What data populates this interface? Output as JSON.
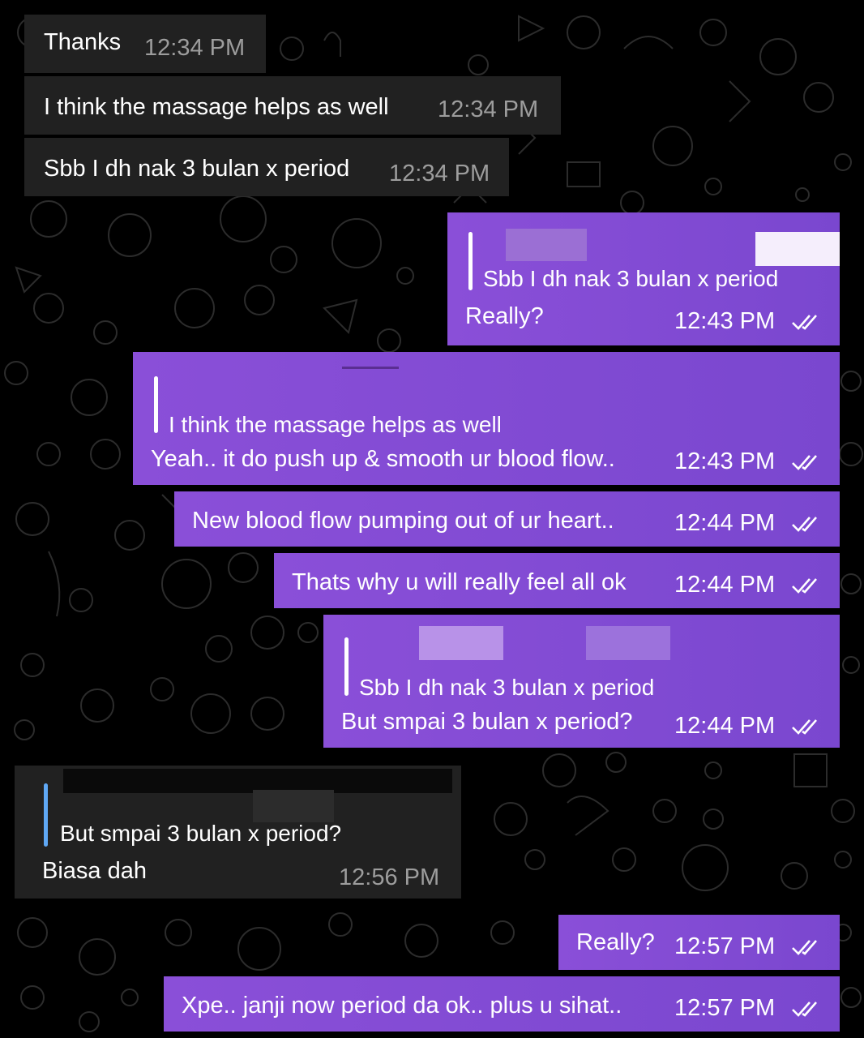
{
  "colors": {
    "background": "#000000",
    "incoming_bubble": "#212121",
    "outgoing_bubble": "#8448d6",
    "reply_bar_incoming": "#5fa8f5",
    "timestamp_incoming": "#9d9d9d"
  },
  "messages": [
    {
      "direction": "in",
      "text": "Thanks",
      "time": "12:34 PM"
    },
    {
      "direction": "in",
      "text": "I think the massage helps as well",
      "time": "12:34 PM"
    },
    {
      "direction": "in",
      "text": "Sbb I dh nak 3 bulan x period",
      "time": "12:34 PM"
    },
    {
      "direction": "out",
      "quote": "Sbb I dh nak 3 bulan x period",
      "text": "Really?",
      "time": "12:43 PM",
      "status_icon": "double-check-icon"
    },
    {
      "direction": "out",
      "quote": "I think the massage helps as well",
      "text": "Yeah.. it do push up & smooth ur blood flow..",
      "time": "12:43 PM",
      "status_icon": "double-check-icon"
    },
    {
      "direction": "out",
      "text": "New blood flow pumping out of ur heart..",
      "time": "12:44 PM",
      "status_icon": "double-check-icon"
    },
    {
      "direction": "out",
      "text": "Thats why u will really feel all ok",
      "time": "12:44 PM",
      "status_icon": "double-check-icon"
    },
    {
      "direction": "out",
      "quote": "Sbb I dh nak 3 bulan x period",
      "text": "But smpai 3 bulan x period?",
      "time": "12:44 PM",
      "status_icon": "double-check-icon"
    },
    {
      "direction": "in",
      "quote": "But smpai 3 bulan x period?",
      "text": "Biasa dah",
      "time": "12:56 PM"
    },
    {
      "direction": "out",
      "text": "Really?",
      "time": "12:57 PM",
      "status_icon": "double-check-icon"
    },
    {
      "direction": "out",
      "text": "Xpe.. janji now period da ok.. plus u sihat..",
      "time": "12:57 PM",
      "status_icon": "double-check-icon"
    }
  ]
}
